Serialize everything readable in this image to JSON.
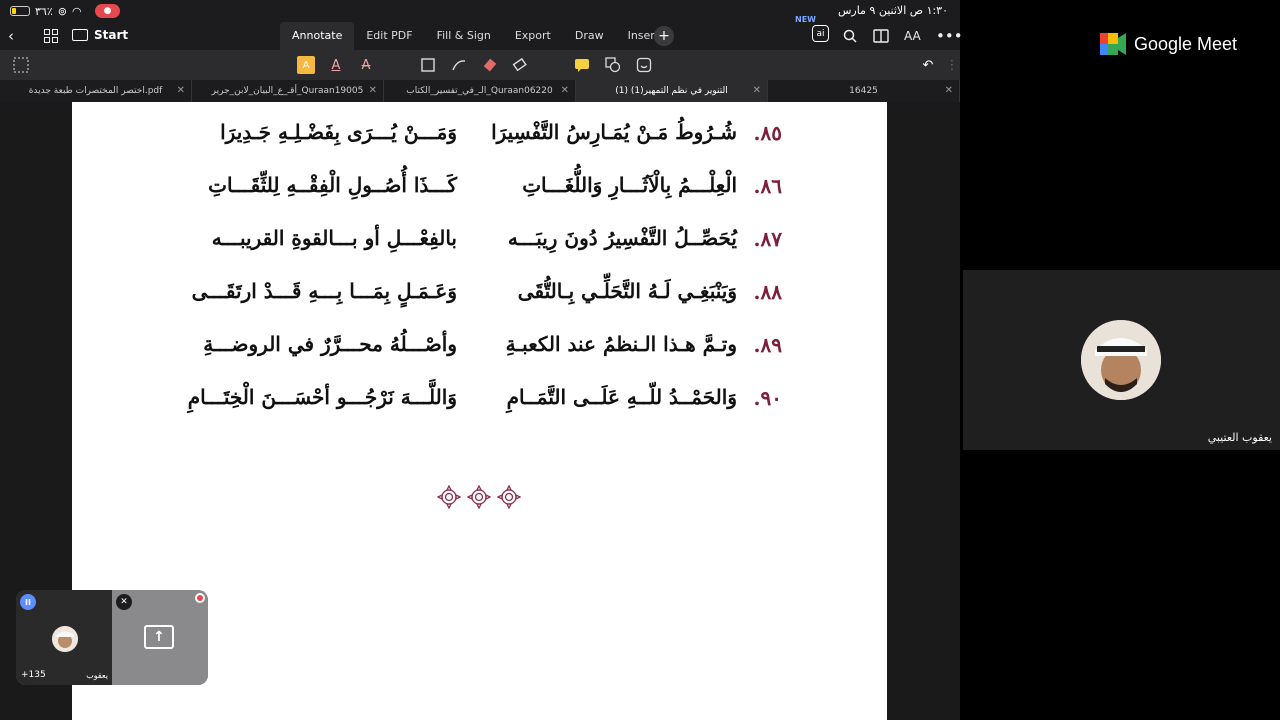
{
  "status_bar": {
    "battery_pct": "٣٦٪",
    "datetime": "١:٣٠ ص   الاثنين ٩ مارس"
  },
  "toolbar": {
    "start_label": "Start",
    "tabs": [
      "Annotate",
      "Edit PDF",
      "Fill & Sign",
      "Export",
      "Draw",
      "Insert"
    ],
    "active_tab": "Annotate",
    "new_badge": "NEW",
    "ai_label": "ai",
    "font_size_label": "AA"
  },
  "doc_tabs": [
    {
      "label": "اختصر المختصرات طبعة جديدة.pdf"
    },
    {
      "label": "أقـ_ع_البيان_لابن_جرير_Quraan19005"
    },
    {
      "label": "الـ_في_تفسير_الكتاب_Quraan06220"
    },
    {
      "label": "التنوير في نظم التمهير(1) (1)"
    },
    {
      "label": "16425"
    }
  ],
  "verses": [
    {
      "num": "٨٥.",
      "right": "شُـرُوطُ مَـنْ يُمَـارِسُ التَّفْسِيرَا",
      "left": "وَمَـــنْ يُـــرَى بِفَضْـلِـهِ جَـدِيرَا"
    },
    {
      "num": "٨٦.",
      "right": "الْعِلْـــمُ بِالْآثَـــارِ وَاللُّغَـــاتِ",
      "left": "كَـــذَا أُصُــولِ الْفِقْــهِ لِلثِّقَـــاتِ"
    },
    {
      "num": "٨٧.",
      "right": "يُحَصِّــلُ التَّفْسِيرُ دُونَ رِيبَـــه",
      "left": "بالفِعْـــلِ أو بـــالقوةِ القريبـــه"
    },
    {
      "num": "٨٨.",
      "right": "وَيَنْبَغِـي لَـهُ التَّحَلِّـي بِـالتُّقَى",
      "left": "وَعَـمَـلٍ بِمَـــا بِـــهِ قَـــدْ ارتَقَـــى"
    },
    {
      "num": "٨٩.",
      "right": "وتـمَّ هـذا الـنظمُ عند الكعبـةِ",
      "left": "وأصْـــلُهُ محـــرَّرٌ في الروضـــةِ"
    },
    {
      "num": "٩٠.",
      "right": "وَالحَمْــدُ للّــهِ عَلَــى التَّمَــامِ",
      "left": "وَاللَّـــهَ نَرْجُـــو أحْسَـــنَ الْخِتَـــامِ"
    }
  ],
  "self_view": {
    "pause_icon": "pause-icon",
    "participant_count": "+135",
    "name": "يعقوب"
  },
  "meet": {
    "brand": "Google Meet",
    "participant_name": "يعقوب العتيبي"
  },
  "colors": {
    "verse_number": "#7b1f3a",
    "ornament": "#8b2e4f",
    "record": "#e5484d",
    "meet_blue": "#4285f4",
    "meet_green": "#34a853",
    "meet_yellow": "#fbbc04",
    "meet_red": "#ea4335"
  }
}
